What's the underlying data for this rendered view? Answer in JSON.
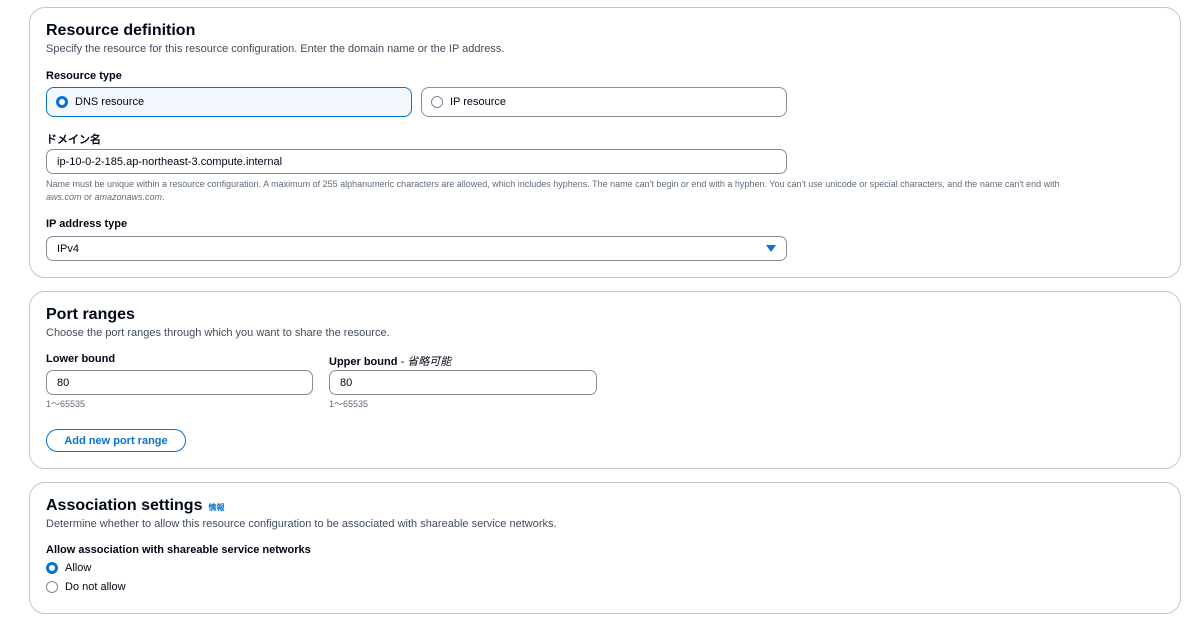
{
  "resource_definition": {
    "title": "Resource definition",
    "description": "Specify the resource for this resource configuration. Enter the domain name or the IP address.",
    "resource_type_label": "Resource type",
    "options": [
      {
        "label": "DNS resource",
        "selected": true
      },
      {
        "label": "IP resource",
        "selected": false
      }
    ],
    "domain_label": "ドメイン名",
    "domain_value": "ip-10-0-2-185.ap-northeast-3.compute.internal",
    "domain_hint_line1": "Name must be unique within a resource configuration. A maximum of 255 alphanumeric characters are allowed, which includes hyphens. The name can't begin or end with a hyphen. You can't use unicode or special characters, and the name can't end with",
    "domain_hint_suffix_1": "aws.com",
    "domain_hint_or": " or ",
    "domain_hint_suffix_2": "amazonaws.com",
    "domain_hint_end": ".",
    "ip_type_label": "IP address type",
    "ip_type_value": "IPv4"
  },
  "port_ranges": {
    "title": "Port ranges",
    "description": "Choose the port ranges through which you want to share the resource.",
    "lower_label": "Lower bound",
    "lower_value": "80",
    "lower_hint": "1〜65535",
    "upper_label": "Upper bound",
    "upper_optional": " - 省略可能",
    "upper_value": "80",
    "upper_hint": "1〜65535",
    "add_button": "Add new port range"
  },
  "association": {
    "title": "Association settings",
    "info_link": "情報",
    "description": "Determine whether to allow this resource configuration to be associated with shareable service networks.",
    "allow_label": "Allow association with shareable service networks",
    "options": [
      {
        "label": "Allow",
        "selected": true
      },
      {
        "label": "Do not allow",
        "selected": false
      }
    ]
  },
  "colors": {
    "accent": "#0972d3",
    "border": "#c6c6cd",
    "text": "#000716",
    "muted": "#5f6b7a"
  },
  "icons": [
    "radio-selected-icon",
    "radio-unselected-icon",
    "caret-down-icon"
  ]
}
